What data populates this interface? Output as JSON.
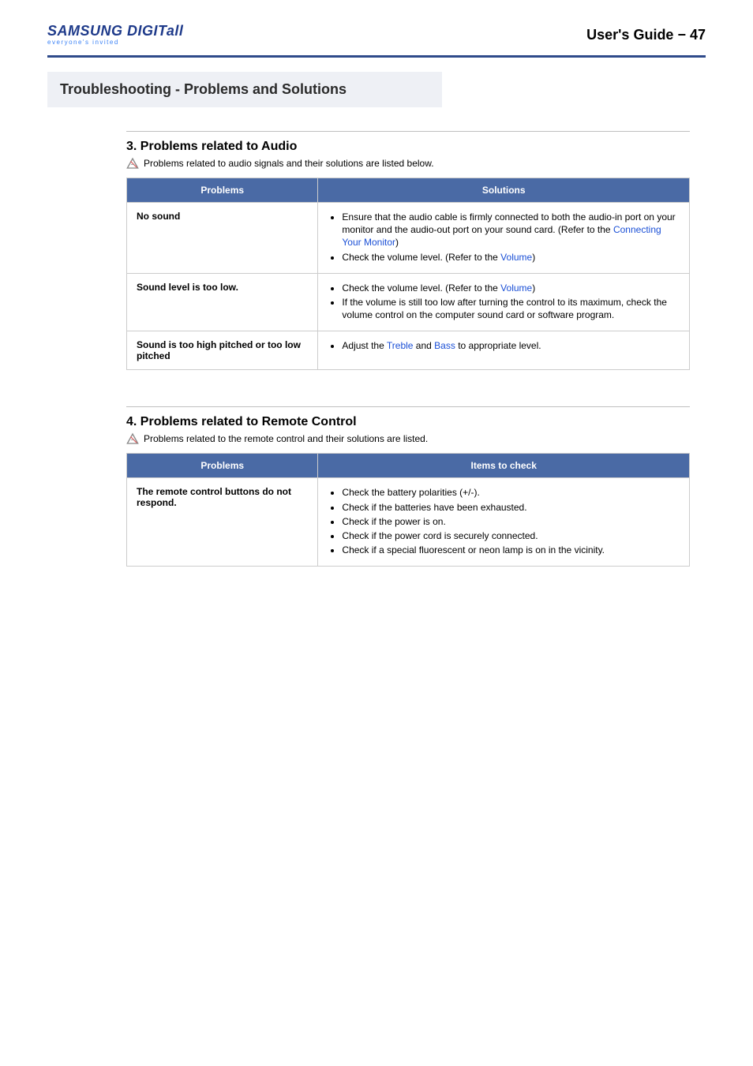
{
  "header": {
    "logo_top": "SAMSUNG DIGITall",
    "logo_bottom": "everyone's invited",
    "guide_label": "User's Guide",
    "page_sep": " − ",
    "page_number": "47"
  },
  "title_band": "Troubleshooting  - Problems and Solutions",
  "sections": [
    {
      "heading": "3. Problems related to Audio",
      "intro": "Problems related to audio signals and their solutions are listed below.",
      "col1": "Problems",
      "col2": "Solutions",
      "rows": [
        {
          "problem": "No sound",
          "items": [
            [
              {
                "t": "Ensure that the audio cable is firmly connected to both the audio-in port on your monitor and the audio-out port on your sound card. (Refer to the "
              },
              {
                "t": "Connecting Your Monitor",
                "link": true
              },
              {
                "t": ")"
              }
            ],
            [
              {
                "t": "Check the volume level. (Refer to the "
              },
              {
                "t": "Volume",
                "link": true
              },
              {
                "t": ")"
              }
            ]
          ]
        },
        {
          "problem": "Sound level is too low.",
          "items": [
            [
              {
                "t": "Check the volume level. (Refer to the "
              },
              {
                "t": "Volume",
                "link": true
              },
              {
                "t": ")"
              }
            ],
            [
              {
                "t": "If the volume is still too low after turning the control to its maximum, check the volume control on the computer sound card or software program."
              }
            ]
          ]
        },
        {
          "problem": "Sound is too high pitched or too low pitched",
          "items": [
            [
              {
                "t": "Adjust the "
              },
              {
                "t": "Treble",
                "link": true
              },
              {
                "t": " and "
              },
              {
                "t": "Bass",
                "link": true
              },
              {
                "t": " to appropriate level."
              }
            ]
          ]
        }
      ]
    },
    {
      "heading": "4. Problems related to Remote Control",
      "intro": "Problems related to the remote control and their solutions are listed.",
      "col1": "Problems",
      "col2": "Items to check",
      "rows": [
        {
          "problem": "The remote control buttons do not respond.",
          "items": [
            [
              {
                "t": "Check the battery polarities (+/-)."
              }
            ],
            [
              {
                "t": "Check if the batteries have been exhausted."
              }
            ],
            [
              {
                "t": "Check if the power is on."
              }
            ],
            [
              {
                "t": "Check if the power cord is securely connected."
              }
            ],
            [
              {
                "t": "Check if a special fluorescent or neon lamp is on in the vicinity."
              }
            ]
          ]
        }
      ]
    }
  ]
}
